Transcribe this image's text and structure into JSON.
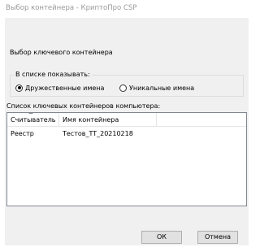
{
  "window": {
    "title": "Выбор контейнера - КриптоПро CSP"
  },
  "dialog": {
    "heading": "Выбор ключевого контейнера",
    "display_group": {
      "legend": "В списке показывать:",
      "options": [
        {
          "label": "Дружественные имена",
          "selected": true
        },
        {
          "label": "Уникальные имена",
          "selected": false
        }
      ]
    },
    "list": {
      "caption": "Список ключевых контейнеров компьютера:",
      "columns": [
        "Считыватель",
        "Имя контейнера"
      ],
      "rows": [
        {
          "reader": "Реестр",
          "name": "Тестов_TT_20210218"
        }
      ]
    },
    "buttons": {
      "ok": "ОК",
      "cancel": "Отмена"
    }
  }
}
